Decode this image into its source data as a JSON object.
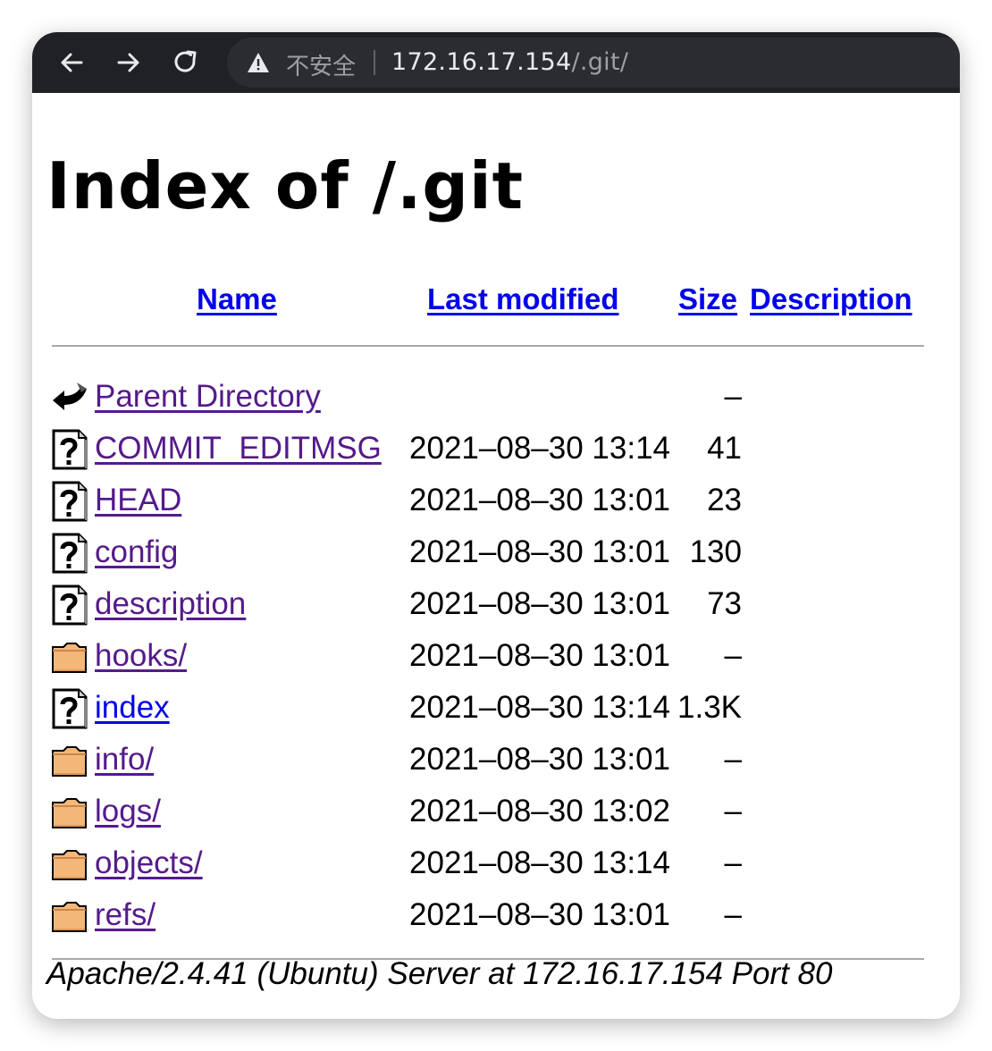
{
  "browser": {
    "security_label": "不安全",
    "url_host": "172.16.17.154",
    "url_path": "/.git/"
  },
  "page": {
    "title": "Index of /.git",
    "columns": {
      "name": "Name",
      "last_modified": "Last modified",
      "size": "Size",
      "description": "Description"
    },
    "rows": [
      {
        "icon": "back-icon",
        "name": "Parent Directory",
        "date": "",
        "size": "–",
        "visited": true
      },
      {
        "icon": "unknown-file-icon",
        "name": "COMMIT_EDITMSG",
        "date": "2021–08–30 13:14",
        "size": "41",
        "visited": true
      },
      {
        "icon": "unknown-file-icon",
        "name": "HEAD",
        "date": "2021–08–30 13:01",
        "size": "23",
        "visited": true
      },
      {
        "icon": "unknown-file-icon",
        "name": "config",
        "date": "2021–08–30 13:01",
        "size": "130",
        "visited": true
      },
      {
        "icon": "unknown-file-icon",
        "name": "description",
        "date": "2021–08–30 13:01",
        "size": "73",
        "visited": true
      },
      {
        "icon": "folder-icon",
        "name": "hooks/",
        "date": "2021–08–30 13:01",
        "size": "–",
        "visited": true
      },
      {
        "icon": "unknown-file-icon",
        "name": "index",
        "date": "2021–08–30 13:14",
        "size": "1.3K",
        "visited": false
      },
      {
        "icon": "folder-icon",
        "name": "info/",
        "date": "2021–08–30 13:01",
        "size": "–",
        "visited": true
      },
      {
        "icon": "folder-icon",
        "name": "logs/",
        "date": "2021–08–30 13:02",
        "size": "–",
        "visited": true
      },
      {
        "icon": "folder-icon",
        "name": "objects/",
        "date": "2021–08–30 13:14",
        "size": "–",
        "visited": true
      },
      {
        "icon": "folder-icon",
        "name": "refs/",
        "date": "2021–08–30 13:01",
        "size": "–",
        "visited": true
      }
    ],
    "footer": "Apache/2.4.41 (Ubuntu) Server at 172.16.17.154 Port 80"
  },
  "colors": {
    "link": "#0000ee",
    "visited_link": "#551a8b",
    "toolbar": "#202124",
    "folder": "#f4b77a"
  }
}
